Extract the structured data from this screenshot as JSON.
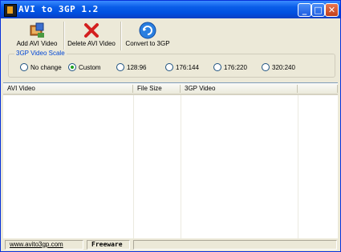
{
  "window": {
    "title": "AVI to 3GP 1.2"
  },
  "toolbar": {
    "add_label": "Add AVI Video",
    "delete_label": "Delete AVI Video",
    "convert_label": "Convert to 3GP"
  },
  "scale": {
    "legend": "3GP Video Scale",
    "options": [
      "No change",
      "Custom",
      "128:96",
      "176:144",
      "176:220",
      "320:240"
    ],
    "selected": "Custom"
  },
  "list": {
    "columns": [
      "AVI Video",
      "File Size",
      "3GP Video"
    ],
    "rows": []
  },
  "status": {
    "link": "www.avito3gp.com",
    "license": "Freeware"
  },
  "colors": {
    "title_bar": "#0a5ee8",
    "legend_text": "#0046d5",
    "window_bg": "#ece9d8"
  }
}
